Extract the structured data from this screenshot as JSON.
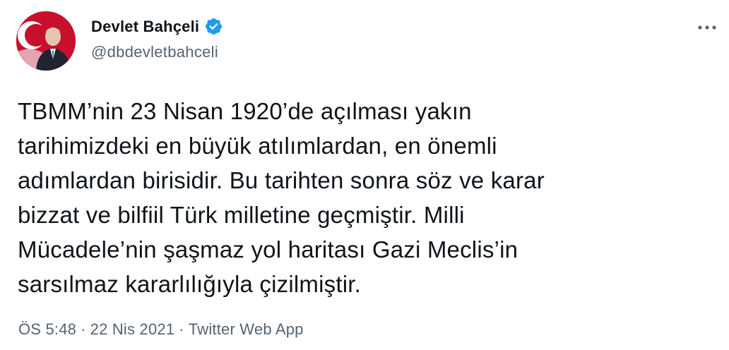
{
  "author": {
    "display_name": "Devlet Bahçeli",
    "handle": "@dbdevletbahceli",
    "verified": true,
    "avatar_icon": "profile-photo"
  },
  "tweet": {
    "text": "TBMM’nin 23 Nisan 1920’de açılması yakın\ntarihimizdeki en büyük atılımlardan, en önemli\nadımlardan birisidir. Bu tarihten sonra söz ve karar\nbizzat ve bilfiil Türk milletine geçmiştir. Milli\nMücadele’nin şaşmaz yol haritası Gazi Meclis’in\nsarsılmaz kararlılığıyla çizilmiştir."
  },
  "meta": {
    "time": "ÖS 5:48",
    "separator": "·",
    "date": "22 Nis 2021",
    "source": "Twitter Web App"
  },
  "colors": {
    "verified_blue": "#1d9bf0",
    "text_primary": "#0f1419",
    "text_secondary": "#536471",
    "avatar_red": "#c8102e"
  },
  "icons": {
    "more": "more-dots-icon",
    "verified": "verified-badge-icon"
  }
}
